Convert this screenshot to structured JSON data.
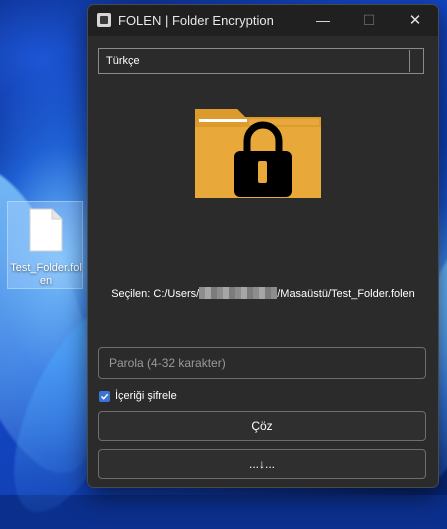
{
  "desktop": {
    "icon_label": "Test_Folder.folen"
  },
  "window": {
    "title": "FOLEN | Folder Encryption",
    "controls": {
      "minimize": "—",
      "maximize": "☐",
      "close": "✕"
    }
  },
  "language": {
    "selected": "Türkçe"
  },
  "selection": {
    "prefix": "Seçilen: C:/Users/",
    "suffix": "/Masaüstü/Test_Folder.folen"
  },
  "password": {
    "placeholder": "Parola (4-32 karakter)",
    "value": ""
  },
  "encrypt_contents": {
    "label": "İçeriği şifrele",
    "checked": true
  },
  "buttons": {
    "decrypt": "Çöz",
    "progress": "...↓..."
  },
  "colors": {
    "folder": "#e8a93a",
    "lock": "#000000",
    "accent": "#3a74d6",
    "window_bg": "#2b2b2b",
    "titlebar_bg": "#202020"
  },
  "icons": {
    "app": "app-icon",
    "folder_lock": "folder-lock-icon",
    "desktop_file": "file-icon"
  }
}
